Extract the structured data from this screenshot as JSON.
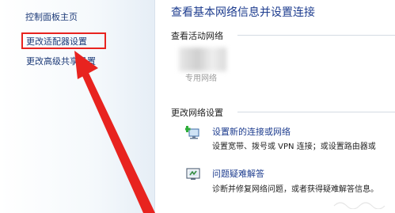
{
  "sidebar": {
    "items": [
      {
        "label": "控制面板主页"
      },
      {
        "label": "更改适配器设置"
      },
      {
        "label": "更改高级共享设置"
      }
    ]
  },
  "main": {
    "title": "查看基本网络信息并设置连接",
    "active_networks_label": "查看活动网络",
    "network_type": "专用网络",
    "change_settings_label": "更改网络设置",
    "tasks": [
      {
        "link": "设置新的连接或网络",
        "description": "设置宽带、拨号或 VPN 连接；或设置路由器或",
        "icon": "new-connection-icon"
      },
      {
        "link": "问题疑难解答",
        "description": "诊断并修复网络问题，或者获得疑难解答信息。",
        "icon": "troubleshoot-icon"
      }
    ]
  },
  "colors": {
    "link": "#1e3d8f",
    "annotation": "#e8231f"
  }
}
